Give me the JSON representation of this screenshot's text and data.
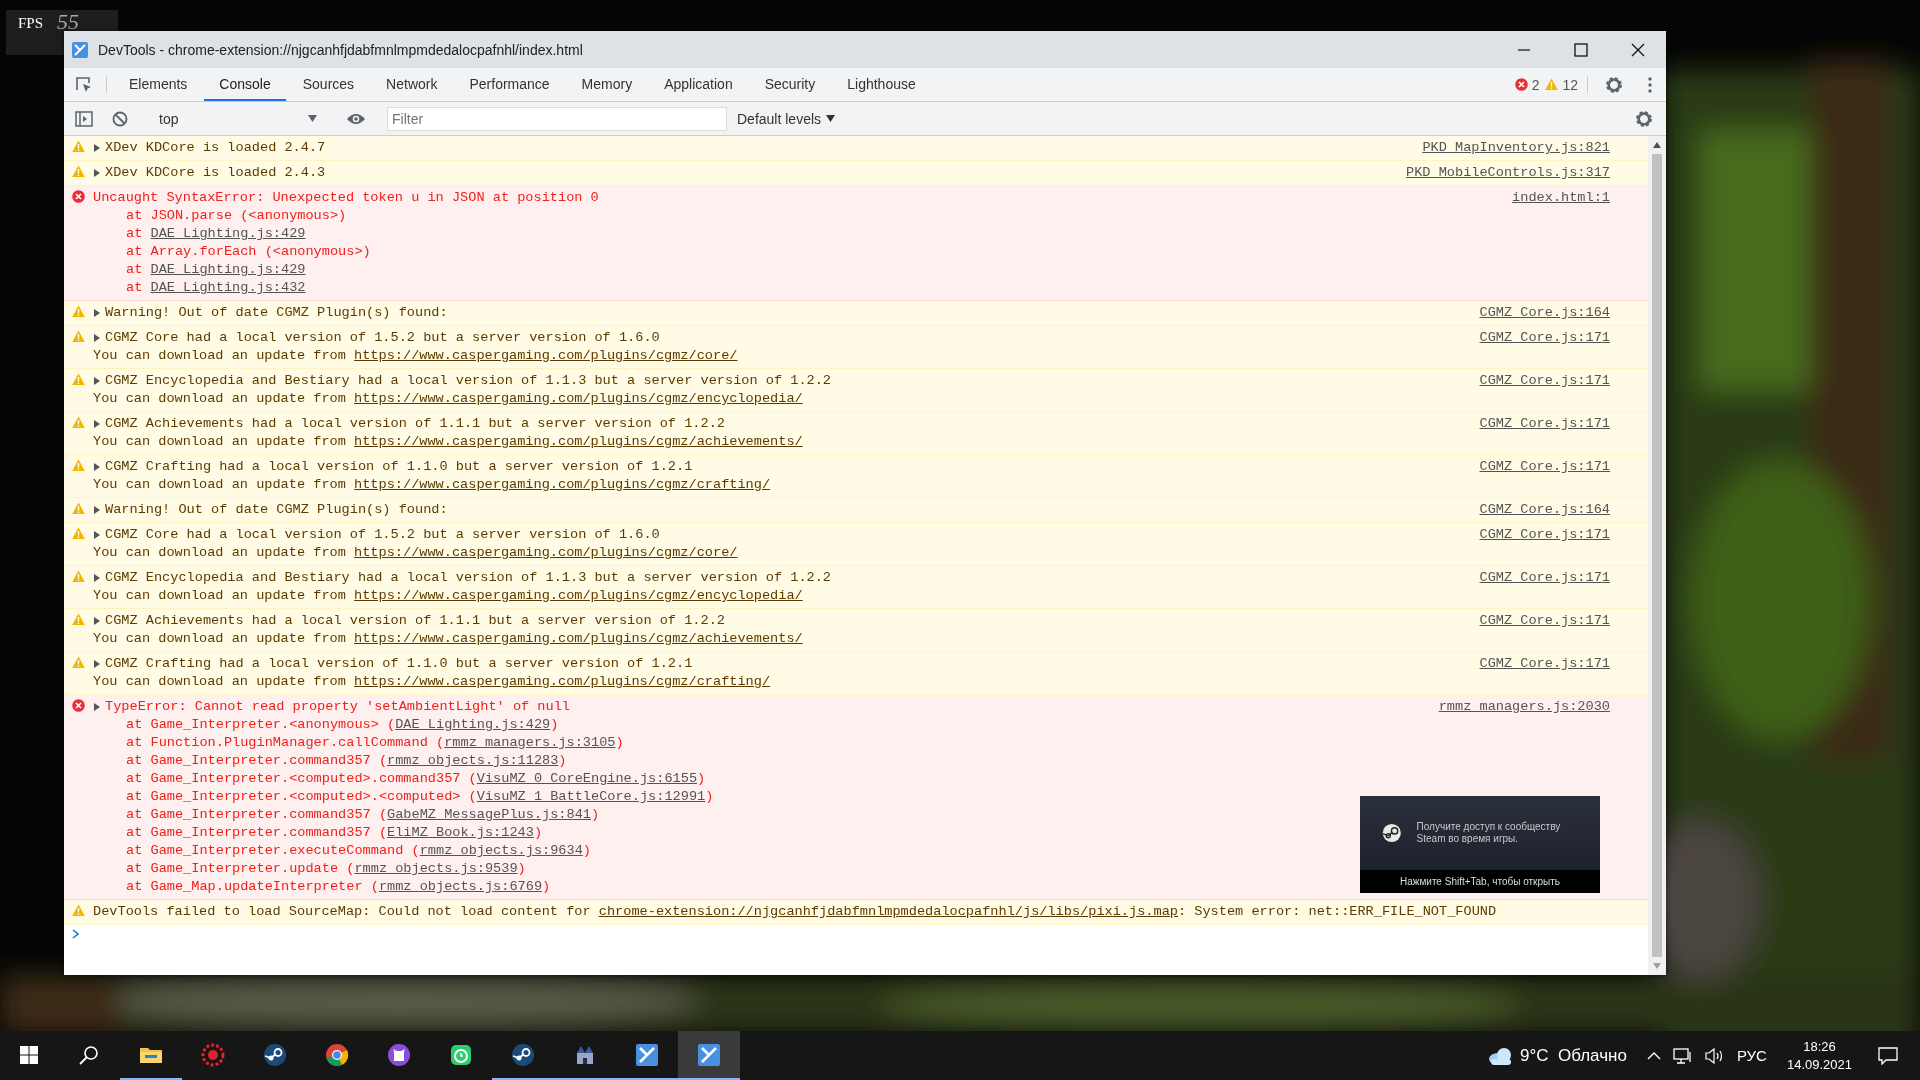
{
  "fps_counter": {
    "label": "FPS",
    "value": "55"
  },
  "window": {
    "title": "DevTools - chrome-extension://njgcanhfjdabfmnlmpmdedalocpafnhl/index.html"
  },
  "tabs": [
    {
      "label": "Elements",
      "selected": false
    },
    {
      "label": "Console",
      "selected": true
    },
    {
      "label": "Sources",
      "selected": false
    },
    {
      "label": "Network",
      "selected": false
    },
    {
      "label": "Performance",
      "selected": false
    },
    {
      "label": "Memory",
      "selected": false
    },
    {
      "label": "Application",
      "selected": false
    },
    {
      "label": "Security",
      "selected": false
    },
    {
      "label": "Lighthouse",
      "selected": false
    }
  ],
  "issue_counts": {
    "errors": "2",
    "warnings": "12"
  },
  "toolbar": {
    "context": "top",
    "filter": {
      "placeholder": "Filter"
    },
    "levels": "Default levels"
  },
  "messages": [
    {
      "kind": "warning",
      "expandable": true,
      "line": [
        {
          "kind": "text",
          "text": "XDev KDCore is loaded 2.4.7"
        }
      ],
      "source": "PKD_MapInventory.js:821"
    },
    {
      "kind": "warning",
      "expandable": true,
      "line": [
        {
          "kind": "text",
          "text": "XDev KDCore is loaded 2.4.3"
        }
      ],
      "source": "PKD_MobileControls.js:317"
    },
    {
      "kind": "error",
      "expandable": false,
      "line": [
        {
          "kind": "text",
          "text": "Uncaught SyntaxError: Unexpected token u in JSON at position 0"
        }
      ],
      "source": "index.html:1",
      "stack": [
        [
          {
            "kind": "text",
            "text": "at JSON.parse (<anonymous>)"
          }
        ],
        [
          {
            "kind": "text",
            "text": "at "
          },
          {
            "kind": "link",
            "text": "DAE_Lighting.js:429"
          }
        ],
        [
          {
            "kind": "text",
            "text": "at Array.forEach (<anonymous>)"
          }
        ],
        [
          {
            "kind": "text",
            "text": "at "
          },
          {
            "kind": "link",
            "text": "DAE_Lighting.js:429"
          }
        ],
        [
          {
            "kind": "text",
            "text": "at "
          },
          {
            "kind": "link",
            "text": "DAE_Lighting.js:432"
          }
        ]
      ]
    },
    {
      "kind": "warning",
      "expandable": true,
      "line": [
        {
          "kind": "text",
          "text": "Warning! Out of date CGMZ Plugin(s) found:"
        }
      ],
      "source": "CGMZ_Core.js:164"
    },
    {
      "kind": "warning",
      "expandable": true,
      "line": [
        {
          "kind": "text",
          "text": "CGMZ Core had a local version of 1.5.2 but a server version of 1.6.0"
        }
      ],
      "source": "CGMZ_Core.js:171",
      "details": [
        [
          {
            "kind": "text",
            "text": "You can download an update from "
          },
          {
            "kind": "link",
            "text": "https://www.caspergaming.com/plugins/cgmz/core/"
          }
        ]
      ]
    },
    {
      "kind": "warning",
      "expandable": true,
      "line": [
        {
          "kind": "text",
          "text": "CGMZ Encyclopedia and Bestiary had a local version of 1.1.3 but a server version of 1.2.2"
        }
      ],
      "source": "CGMZ_Core.js:171",
      "details": [
        [
          {
            "kind": "text",
            "text": "You can download an update from "
          },
          {
            "kind": "link",
            "text": "https://www.caspergaming.com/plugins/cgmz/encyclopedia/"
          }
        ]
      ]
    },
    {
      "kind": "warning",
      "expandable": true,
      "line": [
        {
          "kind": "text",
          "text": "CGMZ Achievements had a local version of 1.1.1 but a server version of 1.2.2"
        }
      ],
      "source": "CGMZ_Core.js:171",
      "details": [
        [
          {
            "kind": "text",
            "text": "You can download an update from "
          },
          {
            "kind": "link",
            "text": "https://www.caspergaming.com/plugins/cgmz/achievements/"
          }
        ]
      ]
    },
    {
      "kind": "warning",
      "expandable": true,
      "line": [
        {
          "kind": "text",
          "text": "CGMZ Crafting had a local version of 1.1.0 but a server version of 1.2.1"
        }
      ],
      "source": "CGMZ_Core.js:171",
      "details": [
        [
          {
            "kind": "text",
            "text": "You can download an update from "
          },
          {
            "kind": "link",
            "text": "https://www.caspergaming.com/plugins/cgmz/crafting/"
          }
        ]
      ]
    },
    {
      "kind": "warning",
      "expandable": true,
      "line": [
        {
          "kind": "text",
          "text": "Warning! Out of date CGMZ Plugin(s) found:"
        }
      ],
      "source": "CGMZ_Core.js:164"
    },
    {
      "kind": "warning",
      "expandable": true,
      "line": [
        {
          "kind": "text",
          "text": "CGMZ Core had a local version of 1.5.2 but a server version of 1.6.0"
        }
      ],
      "source": "CGMZ_Core.js:171",
      "details": [
        [
          {
            "kind": "text",
            "text": "You can download an update from "
          },
          {
            "kind": "link",
            "text": "https://www.caspergaming.com/plugins/cgmz/core/"
          }
        ]
      ]
    },
    {
      "kind": "warning",
      "expandable": true,
      "line": [
        {
          "kind": "text",
          "text": "CGMZ Encyclopedia and Bestiary had a local version of 1.1.3 but a server version of 1.2.2"
        }
      ],
      "source": "CGMZ_Core.js:171",
      "details": [
        [
          {
            "kind": "text",
            "text": "You can download an update from "
          },
          {
            "kind": "link",
            "text": "https://www.caspergaming.com/plugins/cgmz/encyclopedia/"
          }
        ]
      ]
    },
    {
      "kind": "warning",
      "expandable": true,
      "line": [
        {
          "kind": "text",
          "text": "CGMZ Achievements had a local version of 1.1.1 but a server version of 1.2.2"
        }
      ],
      "source": "CGMZ_Core.js:171",
      "details": [
        [
          {
            "kind": "text",
            "text": "You can download an update from "
          },
          {
            "kind": "link",
            "text": "https://www.caspergaming.com/plugins/cgmz/achievements/"
          }
        ]
      ]
    },
    {
      "kind": "warning",
      "expandable": true,
      "line": [
        {
          "kind": "text",
          "text": "CGMZ Crafting had a local version of 1.1.0 but a server version of 1.2.1"
        }
      ],
      "source": "CGMZ_Core.js:171",
      "details": [
        [
          {
            "kind": "text",
            "text": "You can download an update from "
          },
          {
            "kind": "link",
            "text": "https://www.caspergaming.com/plugins/cgmz/crafting/"
          }
        ]
      ]
    },
    {
      "kind": "error",
      "expandable": true,
      "line": [
        {
          "kind": "text",
          "text": "TypeError: Cannot read property 'setAmbientLight' of null"
        }
      ],
      "source": "rmmz_managers.js:2030",
      "stack": [
        [
          {
            "kind": "text",
            "text": "at Game_Interpreter.<anonymous> ("
          },
          {
            "kind": "link",
            "text": "DAE_Lighting.js:429"
          },
          {
            "kind": "text",
            "text": ")"
          }
        ],
        [
          {
            "kind": "text",
            "text": "at Function.PluginManager.callCommand ("
          },
          {
            "kind": "link",
            "text": "rmmz_managers.js:3105"
          },
          {
            "kind": "text",
            "text": ")"
          }
        ],
        [
          {
            "kind": "text",
            "text": "at Game_Interpreter.command357 ("
          },
          {
            "kind": "link",
            "text": "rmmz_objects.js:11283"
          },
          {
            "kind": "text",
            "text": ")"
          }
        ],
        [
          {
            "kind": "text",
            "text": "at Game_Interpreter.<computed>.command357 ("
          },
          {
            "kind": "link",
            "text": "VisuMZ_0_CoreEngine.js:6155"
          },
          {
            "kind": "text",
            "text": ")"
          }
        ],
        [
          {
            "kind": "text",
            "text": "at Game_Interpreter.<computed>.<computed> ("
          },
          {
            "kind": "link",
            "text": "VisuMZ_1_BattleCore.js:12991"
          },
          {
            "kind": "text",
            "text": ")"
          }
        ],
        [
          {
            "kind": "text",
            "text": "at Game_Interpreter.command357 ("
          },
          {
            "kind": "link",
            "text": "GabeMZ_MessagePlus.js:841"
          },
          {
            "kind": "text",
            "text": ")"
          }
        ],
        [
          {
            "kind": "text",
            "text": "at Game_Interpreter.command357 ("
          },
          {
            "kind": "link",
            "text": "EliMZ_Book.js:1243"
          },
          {
            "kind": "text",
            "text": ")"
          }
        ],
        [
          {
            "kind": "text",
            "text": "at Game_Interpreter.executeCommand ("
          },
          {
            "kind": "link",
            "text": "rmmz_objects.js:9634"
          },
          {
            "kind": "text",
            "text": ")"
          }
        ],
        [
          {
            "kind": "text",
            "text": "at Game_Interpreter.update ("
          },
          {
            "kind": "link",
            "text": "rmmz_objects.js:9539"
          },
          {
            "kind": "text",
            "text": ")"
          }
        ],
        [
          {
            "kind": "text",
            "text": "at Game_Map.updateInterpreter ("
          },
          {
            "kind": "link",
            "text": "rmmz_objects.js:6769"
          },
          {
            "kind": "text",
            "text": ")"
          }
        ]
      ]
    },
    {
      "kind": "warning",
      "expandable": false,
      "line": [
        {
          "kind": "text",
          "text": "DevTools failed to load SourceMap: Could not load content for "
        },
        {
          "kind": "link",
          "text": "chrome-extension://njgcanhfjdabfmnlmpmdedalocpafnhl/js/libs/pixi.js.map"
        },
        {
          "kind": "text",
          "text": ": System error: net::ERR_FILE_NOT_FOUND"
        }
      ]
    }
  ],
  "steam_overlay": {
    "message": "Получите доступ к сообществу Steam во время игры.",
    "hint": "Нажмите Shift+Tab, чтобы открыть"
  },
  "taskbar": {
    "apps": [
      {
        "kind": "folder",
        "running": true,
        "selected": false
      },
      {
        "kind": "red-gear",
        "running": false,
        "selected": false
      },
      {
        "kind": "steam",
        "running": false,
        "selected": false
      },
      {
        "kind": "browser",
        "running": false,
        "selected": false
      },
      {
        "kind": "github",
        "running": false,
        "selected": false
      },
      {
        "kind": "green-app",
        "running": false,
        "selected": false
      },
      {
        "kind": "steam",
        "running": true,
        "selected": false
      },
      {
        "kind": "castle",
        "running": true,
        "selected": false
      },
      {
        "kind": "devtools",
        "running": true,
        "selected": false
      },
      {
        "kind": "devtools",
        "running": true,
        "selected": true
      }
    ],
    "weather": "9°C  Облачно",
    "language": "РУС",
    "time": "18:26",
    "date": "14.09.2021"
  }
}
